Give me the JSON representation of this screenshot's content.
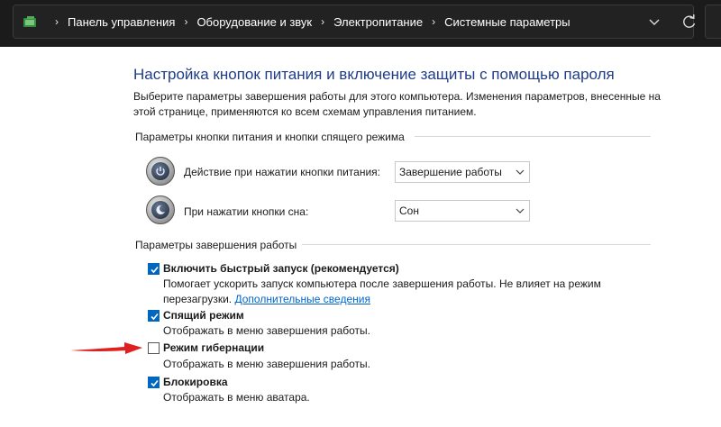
{
  "breadcrumb": {
    "items": [
      "Панель управления",
      "Оборудование и звук",
      "Электропитание",
      "Системные параметры"
    ],
    "separator": "›"
  },
  "page": {
    "title": "Настройка кнопок питания и включение защиты с помощью пароля",
    "description": "Выберите параметры завершения работы для этого компьютера. Изменения параметров, внесенные на этой странице, применяются ко всем схемам управления питанием."
  },
  "power_buttons_group": {
    "title": "Параметры кнопки питания и кнопки спящего режима",
    "rows": [
      {
        "label": "Действие при нажатии кнопки питания:",
        "value": "Завершение работы",
        "icon": "power-button-icon"
      },
      {
        "label": "При нажатии кнопки сна:",
        "value": "Сон",
        "icon": "sleep-button-icon"
      }
    ]
  },
  "shutdown_group": {
    "title": "Параметры завершения работы",
    "items": [
      {
        "label": "Включить быстрый запуск (рекомендуется)",
        "checked": true,
        "desc": "Помогает ускорить запуск компьютера после завершения работы. Не влияет на режим перезагрузки.",
        "link": "Дополнительные сведения"
      },
      {
        "label": "Спящий режим",
        "checked": true,
        "desc": "Отображать в меню завершения работы."
      },
      {
        "label": "Режим гибернации",
        "checked": false,
        "desc": "Отображать в меню завершения работы."
      },
      {
        "label": "Блокировка",
        "checked": true,
        "desc": "Отображать в меню аватара."
      }
    ]
  },
  "colors": {
    "title_blue": "#1f3c88",
    "checkbox_blue": "#0067c0",
    "arrow_red": "#e02020",
    "link_blue": "#0066cc"
  }
}
